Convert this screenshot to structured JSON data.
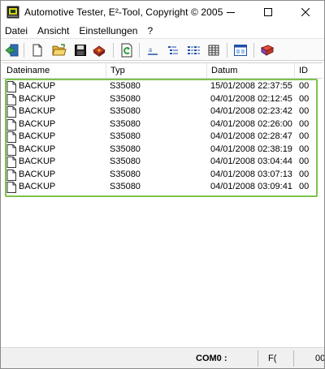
{
  "window": {
    "title": "Automotive Tester, E²-Tool,  Copyright © 2005",
    "controls": [
      "minimize-icon",
      "maximize-icon",
      "close-icon"
    ]
  },
  "menu": [
    "Datei",
    "Ansicht",
    "Einstellungen",
    "?"
  ],
  "toolbar": {
    "buttons": [
      "exit-icon",
      "new-file-icon",
      "open-folder-icon",
      "save-disk-icon",
      "read-device-icon",
      "refresh-icon",
      "large-icons-icon",
      "small-icons-icon",
      "list-view-icon",
      "details-view-icon",
      "properties-icon",
      "help-book-icon"
    ]
  },
  "list": {
    "columns": [
      "Dateiname",
      "Typ",
      "Datum",
      "ID"
    ],
    "rows": [
      [
        "BACKUP",
        "S35080",
        "15/01/2008 22:37:55",
        "00"
      ],
      [
        "BACKUP",
        "S35080",
        "04/01/2008 02:12:45",
        "00"
      ],
      [
        "BACKUP",
        "S35080",
        "04/01/2008 02:23:42",
        "00"
      ],
      [
        "BACKUP",
        "S35080",
        "04/01/2008 02:26:00",
        "00"
      ],
      [
        "BACKUP",
        "S35080",
        "04/01/2008 02:28:47",
        "00"
      ],
      [
        "BACKUP",
        "S35080",
        "04/01/2008 02:38:19",
        "00"
      ],
      [
        "BACKUP",
        "S35080",
        "04/01/2008 03:04:44",
        "00"
      ],
      [
        "BACKUP",
        "S35080",
        "04/01/2008 03:07:13",
        "00"
      ],
      [
        "BACKUP",
        "S35080",
        "04/01/2008 03:09:41",
        "00"
      ]
    ],
    "highlight_color": "#7dc24b"
  },
  "status": {
    "port": "COM0 :",
    "pane2": "F(",
    "pane3": "00"
  }
}
